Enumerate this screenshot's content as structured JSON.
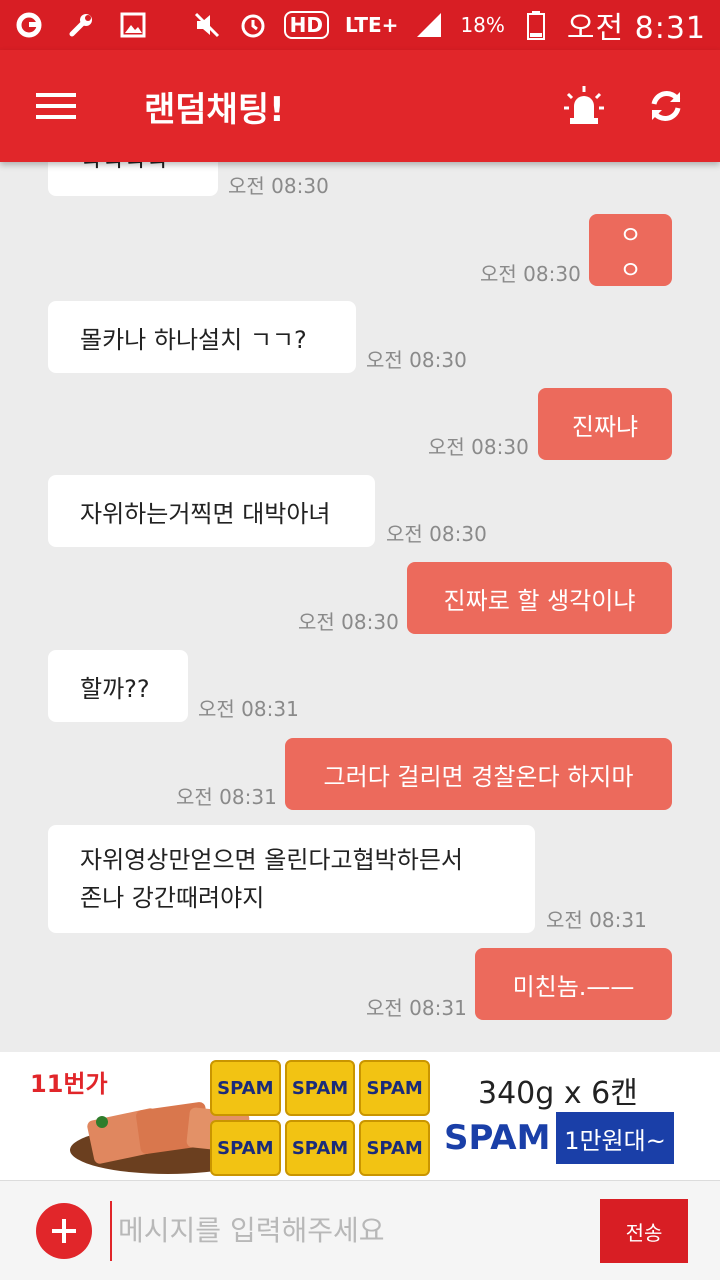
{
  "status_bar": {
    "battery_percent": "18%",
    "network": "LTE+",
    "hd": "HD",
    "time": "오전 8:31"
  },
  "app_bar": {
    "title": "랜덤채팅!"
  },
  "messages": [
    {
      "side": "in",
      "text": "ㅋㅋㅋㅋ",
      "time": "오전 08:30"
    },
    {
      "side": "out",
      "text": "ㅇㅇ",
      "time": "오전 08:30"
    },
    {
      "side": "in",
      "text": "몰카나 하나설치 ㄱㄱ?",
      "time": "오전 08:30"
    },
    {
      "side": "out",
      "text": "진짜냐",
      "time": "오전 08:30"
    },
    {
      "side": "in",
      "text": "자위하는거찍면 대박아녀",
      "time": "오전 08:30"
    },
    {
      "side": "out",
      "text": "진짜로 할 생각이냐",
      "time": "오전 08:30"
    },
    {
      "side": "in",
      "text": "할까??",
      "time": "오전 08:31"
    },
    {
      "side": "out",
      "text": "그러다 걸리면 경찰온다 하지마",
      "time": "오전 08:31"
    },
    {
      "side": "in",
      "text_line1": "자위영상만얻으면 올린다고협박하믄서",
      "text_line2": "존나 강간때려야지",
      "time": "오전 08:31"
    },
    {
      "side": "out",
      "text": "미친놈.——",
      "time": "오전 08:31"
    }
  ],
  "ad": {
    "store": "11번가",
    "can_label": "SPAM",
    "size_text": "340g x 6캔",
    "brand": "SPAM",
    "price": "1만원대~"
  },
  "input": {
    "placeholder": "메시지를 입력해주세요",
    "send_label": "전송"
  },
  "colors": {
    "status_bar": "#d81e24",
    "app_bar": "#e1262a",
    "outgoing_bubble": "#ec6a5c",
    "incoming_bubble": "#ffffff",
    "background": "#ececec"
  }
}
